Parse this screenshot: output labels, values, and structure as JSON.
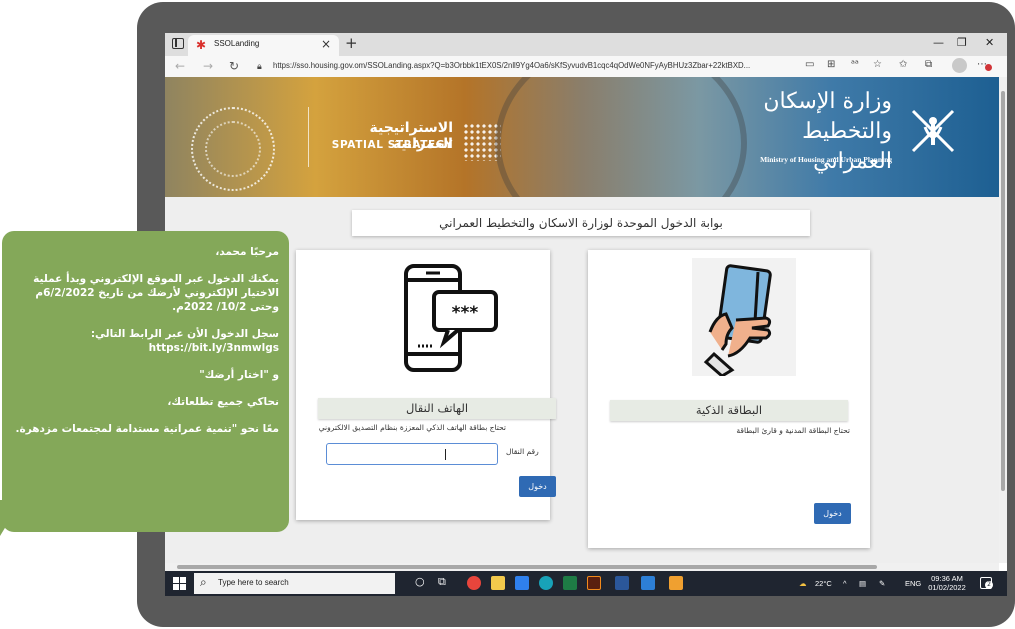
{
  "browser": {
    "tab_title": "SSOLanding",
    "url": "https://sso.housing.gov.om/SSOLanding.aspx?Q=b3Orbbk1tEX0S/2nll9Yg4Oa6/sKfSyvudvB1cqc4qOdWe0NFyAyBHUz3Zbar+22ktBXD..."
  },
  "banner": {
    "ministry_ar_line1": "وزارة الإسكان",
    "ministry_ar_line2": "والتخطيط العمراني",
    "ministry_en": "Ministry of Housing and Urban Planning",
    "strategy_ar": "الاستراتيجية العمرانية",
    "strategy_en": "SPATIAL STRATEGY"
  },
  "page": {
    "portal_title": "بوابة الدخول الموحدة لوزارة الاسكان والتخطيط العمراني",
    "mobile_card": {
      "title": "الهاتف النقال",
      "hint": "تحتاج بطاقة الهاتف الذكي المعززة بنظام التصديق الالكتروني",
      "field_label": "رقم النقال",
      "field_value": "",
      "button": "دخول"
    },
    "smart_card": {
      "title": "البطاقة الذكية",
      "hint": "تحتاج البطاقة المدنية و قارئ البطاقة",
      "button": "دخول"
    }
  },
  "taskbar": {
    "search_placeholder": "Type here to search",
    "weather": "22°C",
    "language": "ENG",
    "time": "09:36 AM",
    "date": "01/02/2022",
    "notifications": "2"
  },
  "callout": {
    "greeting": "مرحبًا محمد،",
    "para1": "يمكنك الدخول عبر الموقع الإلكتروني وبدأ عملية الاختيار الإلكتروني لأرضك من تاريخ 6/2/2022م وحتى 10/2/ 2022م.",
    "para2": "سجل الدخول الأن عبر الرابط التالي: https://bit.ly/3nmwlgs",
    "para3": "و \"اختار أرضك\"",
    "para4": "نحاكي جميع تطلعاتك،",
    "para5": "معًا نحو \"تنمية عمرانية مستدامة لمجتمعات مزدهرة."
  },
  "colors": {
    "callout_green": "#84a859",
    "button_blue": "#2f6ab4",
    "frame_gray": "#595959",
    "taskbar": "#1f2530"
  }
}
